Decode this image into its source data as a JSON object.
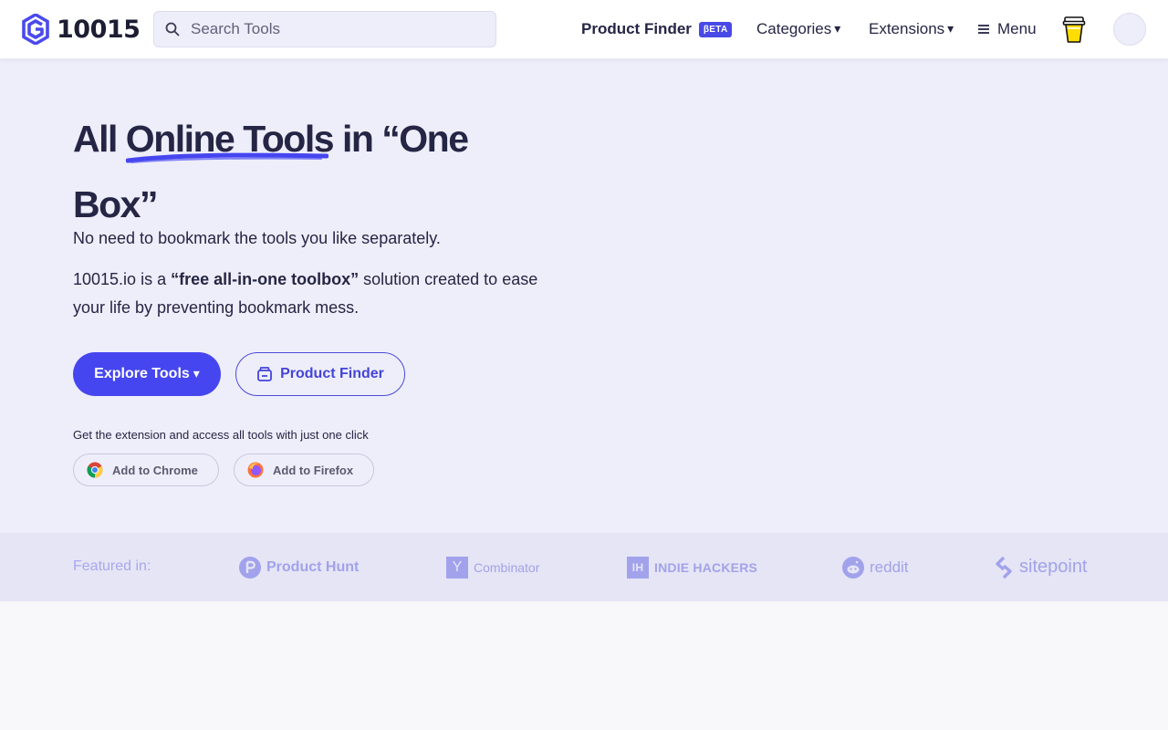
{
  "header": {
    "logo_text": "10015",
    "search_placeholder": "Search Tools",
    "nav": {
      "product_finder": "Product Finder",
      "beta_badge": "βETA",
      "categories": "Categories",
      "extensions": "Extensions",
      "menu": "Menu"
    }
  },
  "hero": {
    "title_pre": "All ",
    "title_highlight": "Online Tools",
    "title_post": " in “One Box”",
    "paragraph1": "No need to bookmark the tools you like separately.",
    "paragraph2_pre": "10015.io is a ",
    "paragraph2_bold": "“free all-in-one toolbox”",
    "paragraph2_post": " solution created to ease your life by preventing bookmark mess.",
    "explore_button": "Explore Tools",
    "product_finder_button": "Product Finder",
    "extension_note": "Get the extension and access all tools with just one click",
    "add_chrome": "Add to Chrome",
    "add_firefox": "Add to Firefox"
  },
  "featured": {
    "label": "Featured in:",
    "logos": {
      "product_hunt": "Product Hunt",
      "ycombinator": "Combinator",
      "ycombinator_mark": "Y",
      "indie_hackers": "INDIE HACKERS",
      "indie_hackers_mark": "IH",
      "reddit": "reddit",
      "sitepoint": "sitepoint"
    }
  },
  "colors": {
    "accent": "#4646f0",
    "hero_bg": "#eeeefa",
    "featured_bg": "#e5e5f5",
    "text": "#252545"
  }
}
